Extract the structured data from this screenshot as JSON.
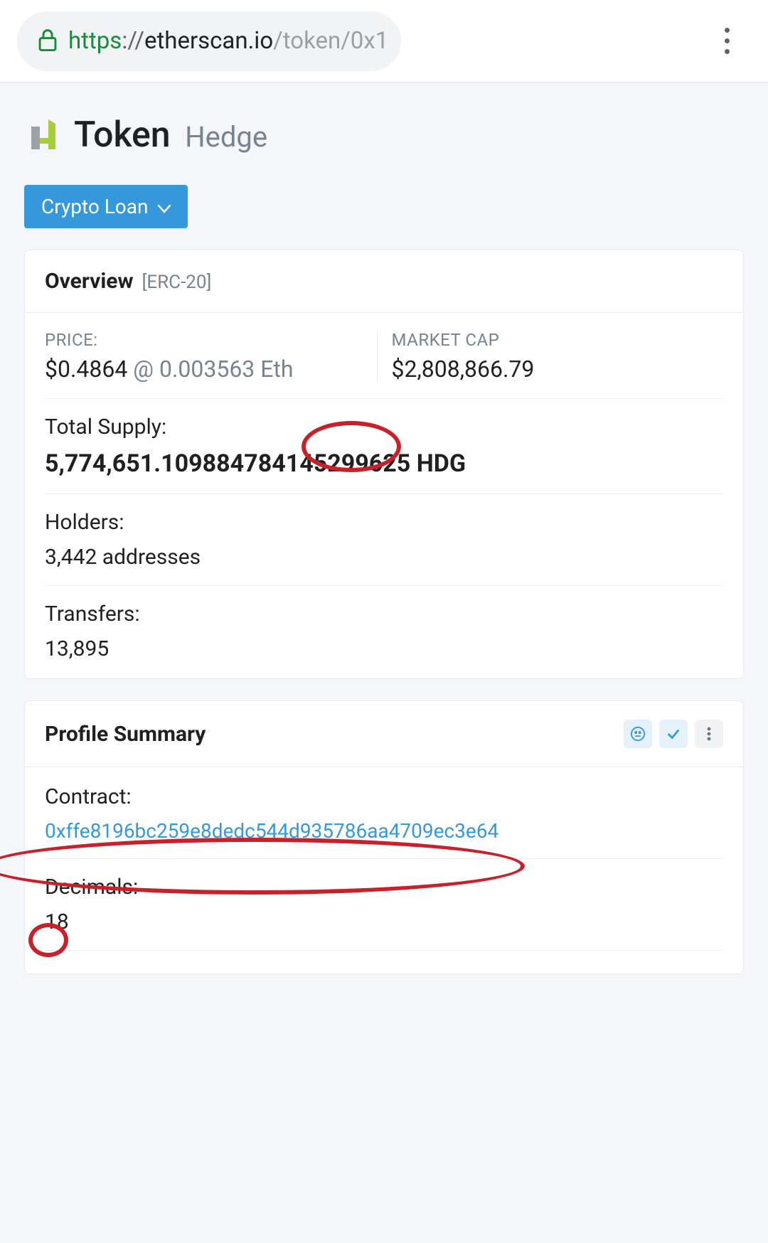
{
  "browser": {
    "url_scheme": "https",
    "url_sep": "://",
    "url_host": "etherscan.io",
    "url_path": "/token/0x1"
  },
  "title": {
    "main": "Token",
    "sub": "Hedge"
  },
  "tag_button": {
    "label": "Crypto Loan"
  },
  "overview": {
    "header": "Overview",
    "header_sub": "[ERC-20]",
    "price_label": "PRICE:",
    "price_value": "$0.4864",
    "price_eth": "@ 0.003563 Eth",
    "mcap_label": "MARKET CAP",
    "mcap_value": "$2,808,866.79",
    "supply_label": "Total Supply:",
    "supply_value": "5,774,651.10988478414529962",
    "supply_tail": "5 HDG",
    "holders_label": "Holders:",
    "holders_value": "3,442 addresses",
    "transfers_label": "Transfers:",
    "transfers_value": "13,895"
  },
  "profile": {
    "header": "Profile Summary",
    "contract_label": "Contract:",
    "contract_value": "0xffe8196bc259e8dedc544d935786aa4709ec3e64",
    "decimals_label": "Decimals:",
    "decimals_value": "18"
  }
}
